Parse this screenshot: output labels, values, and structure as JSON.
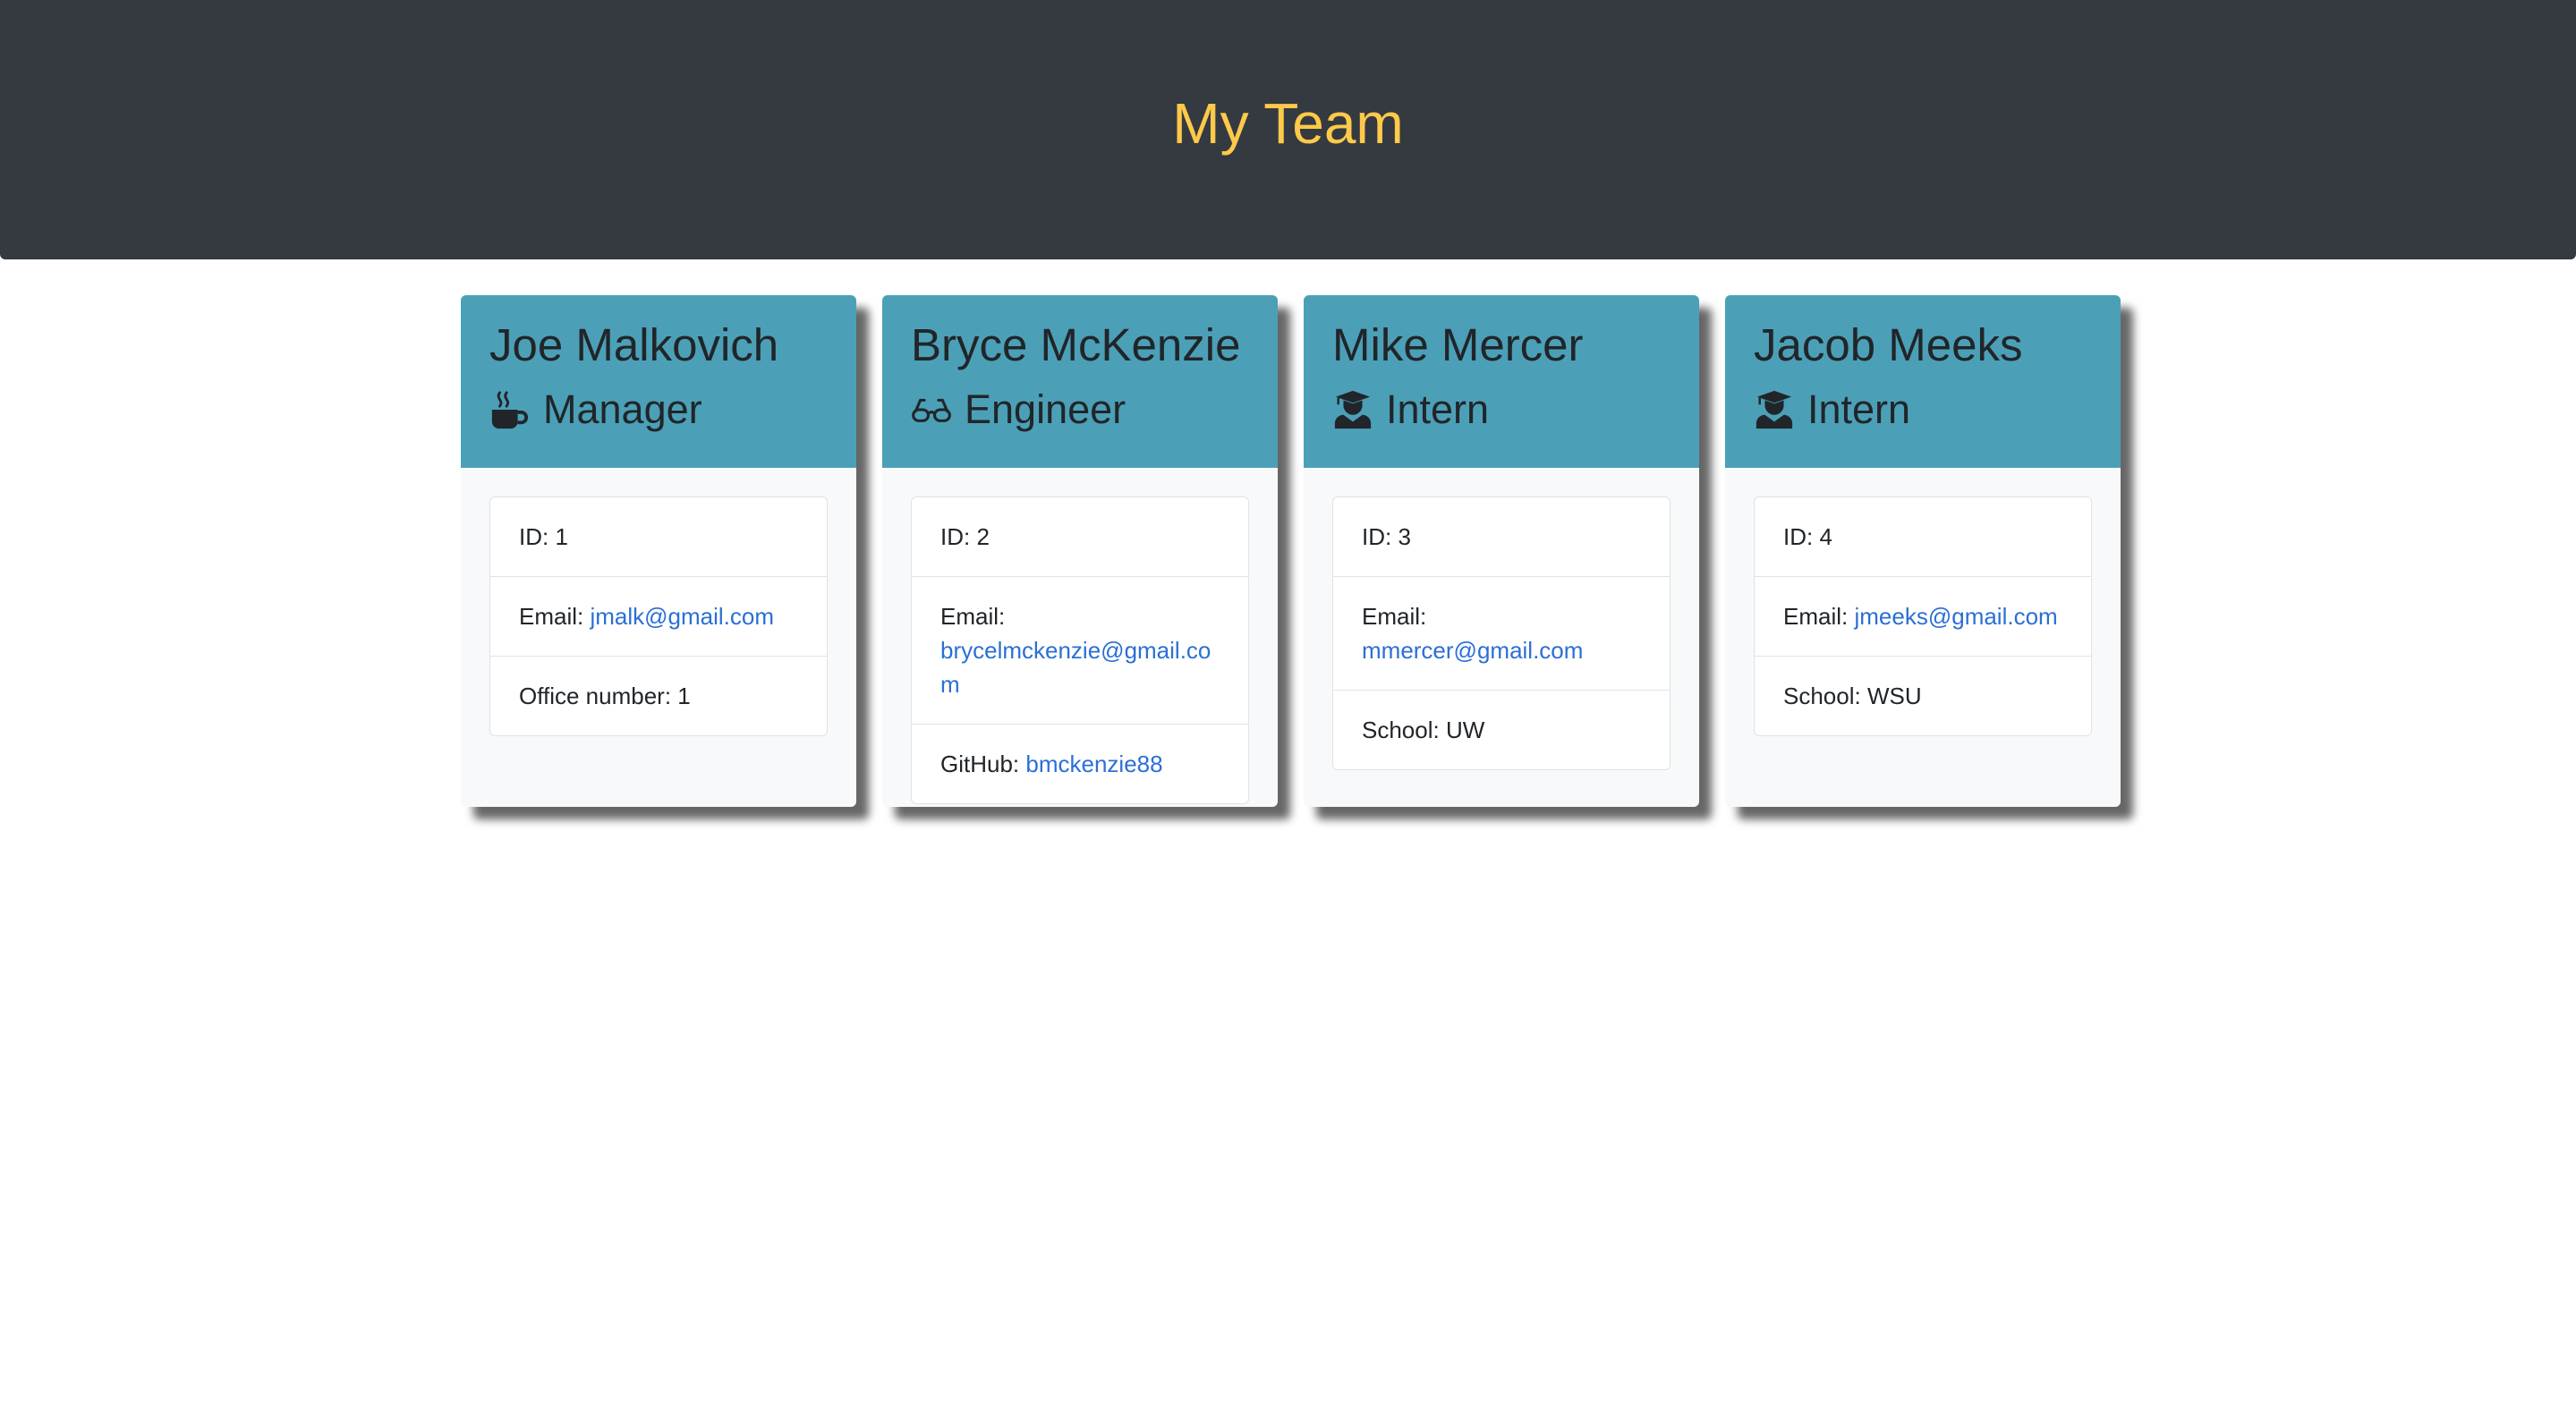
{
  "header": {
    "title": "My Team",
    "title_color": "#ffc94a",
    "background_color": "#343a40"
  },
  "cards": [
    {
      "name": "Joe Malkovich",
      "role": "Manager",
      "role_icon": "mug-hot-icon",
      "id_text": "ID: 1",
      "email_label": "Email:",
      "email": "jmalk@gmail.com",
      "extra_label": "Office number: 1",
      "extra_link": ""
    },
    {
      "name": "Bryce McKenzie",
      "role": "Engineer",
      "role_icon": "glasses-icon",
      "id_text": "ID: 2",
      "email_label": "Email:",
      "email": "brycelmckenzie@gmail.com",
      "extra_label": "GitHub:",
      "extra_link": "bmckenzie88"
    },
    {
      "name": "Mike Mercer",
      "role": "Intern",
      "role_icon": "graduate-icon",
      "id_text": "ID: 3",
      "email_label": "Email:",
      "email": "mmercer@gmail.com",
      "extra_label": "School: UW",
      "extra_link": ""
    },
    {
      "name": "Jacob Meeks",
      "role": "Intern",
      "role_icon": "graduate-icon",
      "id_text": "ID: 4",
      "email_label": "Email:",
      "email": "jmeeks@gmail.com",
      "extra_label": "School: WSU",
      "extra_link": ""
    }
  ],
  "colors": {
    "card_header": "#4ba0b7",
    "link": "#2b6fd6"
  }
}
